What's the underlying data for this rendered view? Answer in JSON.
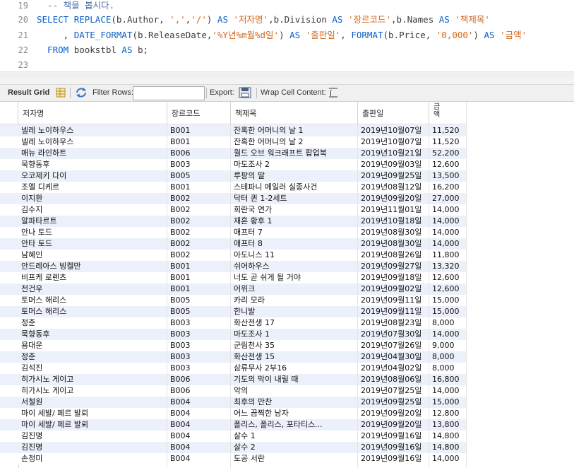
{
  "editor": {
    "lines": [
      {
        "num": "19",
        "parts": [
          {
            "t": "  -- 책을 봅시다.",
            "c": "cmt"
          }
        ]
      },
      {
        "num": "20",
        "parts": [
          {
            "t": "SELECT ",
            "c": "kw"
          },
          {
            "t": "REPLACE",
            "c": "kw"
          },
          {
            "t": "(b.Author, ",
            "c": "plain"
          },
          {
            "t": "','",
            "c": "str"
          },
          {
            "t": ",",
            "c": "plain"
          },
          {
            "t": "'/'",
            "c": "str"
          },
          {
            "t": ") ",
            "c": "plain"
          },
          {
            "t": "AS ",
            "c": "kw"
          },
          {
            "t": "'저자명'",
            "c": "str"
          },
          {
            "t": ",b.Division ",
            "c": "plain"
          },
          {
            "t": "AS ",
            "c": "kw"
          },
          {
            "t": "'장르코드'",
            "c": "str"
          },
          {
            "t": ",b.Names ",
            "c": "plain"
          },
          {
            "t": "AS ",
            "c": "kw"
          },
          {
            "t": "'책제목'",
            "c": "str"
          }
        ]
      },
      {
        "num": "21",
        "parts": [
          {
            "t": "     , ",
            "c": "plain"
          },
          {
            "t": "DATE_FORMAT",
            "c": "kw"
          },
          {
            "t": "(b.ReleaseDate,",
            "c": "plain"
          },
          {
            "t": "'%Y년%m월%d일'",
            "c": "str"
          },
          {
            "t": ") ",
            "c": "plain"
          },
          {
            "t": "AS ",
            "c": "kw"
          },
          {
            "t": "'출판일'",
            "c": "str"
          },
          {
            "t": ", ",
            "c": "plain"
          },
          {
            "t": "FORMAT",
            "c": "kw"
          },
          {
            "t": "(b.Price, ",
            "c": "plain"
          },
          {
            "t": "'0,000'",
            "c": "str"
          },
          {
            "t": ") ",
            "c": "plain"
          },
          {
            "t": "AS ",
            "c": "kw"
          },
          {
            "t": "'금액'",
            "c": "str"
          }
        ]
      },
      {
        "num": "22",
        "parts": [
          {
            "t": "  FROM ",
            "c": "kw"
          },
          {
            "t": "bookstbl ",
            "c": "plain"
          },
          {
            "t": "AS ",
            "c": "kw"
          },
          {
            "t": "b;",
            "c": "plain"
          }
        ]
      },
      {
        "num": "23",
        "parts": []
      }
    ]
  },
  "toolbar": {
    "result_grid": "Result Grid",
    "filter_rows": "Filter Rows:",
    "filter_value": "",
    "export": "Export:",
    "wrap": "Wrap Cell Content:"
  },
  "grid": {
    "columns": [
      "저자명",
      "장르코드",
      "책제목",
      "출판일",
      "금\n액"
    ],
    "rows": [
      [
        "넬레 노이하우스",
        "B001",
        "잔혹한 어머니의 날 1",
        "2019년10월07일",
        "11,520"
      ],
      [
        "넬레 노이하우스",
        "B001",
        "잔혹한 어머니의 날 2",
        "2019년10월07일",
        "11,520"
      ],
      [
        "매뉴 라인하트",
        "B006",
        "월드 오브 워크래프트 팝업북",
        "2019년10월21일",
        "52,200"
      ],
      [
        "묵향동후",
        "B003",
        "마도조사 2",
        "2019년09월03일",
        "12,600"
      ],
      [
        "오코제키 다이",
        "B005",
        "루팡의 딸",
        "2019년09월25일",
        "13,500"
      ],
      [
        "조엘 디케르",
        "B001",
        "스테파니 메일러 실종사건",
        "2019년08월12일",
        "16,200"
      ],
      [
        "이지환",
        "B002",
        "닥터 퀸 1-2세트",
        "2019년09월20일",
        "27,000"
      ],
      [
        "김수지",
        "B002",
        "희란국 연가",
        "2019년11월01일",
        "14,000"
      ],
      [
        "알파타르트",
        "B002",
        "재혼 황후 1",
        "2019년10월18일",
        "14,000"
      ],
      [
        "안나 토드",
        "B002",
        "애프터 7",
        "2019년08월30일",
        "14,000"
      ],
      [
        "안타 토드",
        "B002",
        "애프터 8",
        "2019년08월30일",
        "14,000"
      ],
      [
        "남혜인",
        "B002",
        "아도니스 11",
        "2019년08월26일",
        "11,800"
      ],
      [
        "안드레아스 빙켈만",
        "B001",
        "쉬어하우스",
        "2019년09월27일",
        "13,320"
      ],
      [
        "비프케 로렌츠",
        "B001",
        "너도 곧 쉬게 될 거야",
        "2019년09월18일",
        "12,600"
      ],
      [
        "전건우",
        "B001",
        "어위크",
        "2019년09월02일",
        "12,600"
      ],
      [
        "토머스 해리스",
        "B005",
        "카리 모라",
        "2019년09월11일",
        "15,000"
      ],
      [
        "토머스 해리스",
        "B005",
        "한니발",
        "2019년09월11일",
        "15,000"
      ],
      [
        "정준",
        "B003",
        "화산전생 17",
        "2019년08월23일",
        "8,000"
      ],
      [
        "묵향동후",
        "B003",
        "마도조사 1",
        "2019년07월30일",
        "14,000"
      ],
      [
        "용대운",
        "B003",
        "군림천사 35",
        "2019년07월26일",
        "9,000"
      ],
      [
        "정준",
        "B003",
        "화산전생 15",
        "2019년04월30일",
        "8,000"
      ],
      [
        "김석진",
        "B003",
        "삼류무사 2부16",
        "2019년04월02일",
        "8,000"
      ],
      [
        "히가시노 게이고",
        "B006",
        "기도의 막이 내릴 때",
        "2019년08월06일",
        "16,800"
      ],
      [
        "히가시노 게이고",
        "B006",
        "악의",
        "2019년07월25일",
        "14,000"
      ],
      [
        "서철원",
        "B004",
        "최후의 만찬",
        "2019년09월25일",
        "15,000"
      ],
      [
        "마이 세발/ 페르 발뢰",
        "B004",
        "어느 끔찍한 남자",
        "2019년09월20일",
        "12,800"
      ],
      [
        "마이 세발/ 페르 발뢰",
        "B004",
        "폴리스, 폴리스, 포타티스...",
        "2019년09월20일",
        "13,800"
      ],
      [
        "김진명",
        "B004",
        "살수 1",
        "2019년09월16일",
        "14,800"
      ],
      [
        "김진명",
        "B004",
        "살수 2",
        "2019년09월16일",
        "14,800"
      ],
      [
        "손정미",
        "B004",
        "도공 서란",
        "2019년09월16일",
        "14,000"
      ]
    ]
  },
  "colors": {
    "odd_row": "#ebf0fa",
    "keyword": "#0a5ec7",
    "string": "#d2691e"
  },
  "icons": [
    "grid-form-icon",
    "refresh-icon",
    "export-icon",
    "wrap-icon"
  ]
}
